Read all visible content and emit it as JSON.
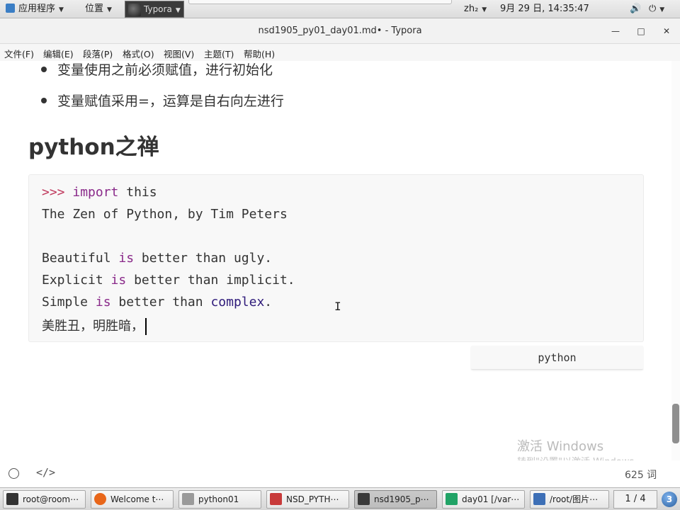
{
  "top_panel": {
    "apps_menu": "应用程序",
    "places_menu": "位置",
    "active_app": "Typora",
    "input_method": "zh₂",
    "datetime": "9月 29 日, 14:35:47"
  },
  "window": {
    "title": "nsd1905_py01_day01.md• - Typora",
    "minimize_glyph": "—",
    "maximize_glyph": "□",
    "close_glyph": "✕"
  },
  "menu": {
    "items": [
      "文件(F)",
      "编辑(E)",
      "段落(P)",
      "格式(O)",
      "视图(V)",
      "主题(T)",
      "帮助(H)"
    ]
  },
  "document": {
    "bullets": [
      "变量使用之前必须赋值，进行初始化",
      "变量赋值采用=，运算是自右向左进行"
    ],
    "heading_latin": "python",
    "heading_cn": "之禅",
    "code": {
      "prompt": ">>>",
      "import_kw": "import",
      "import_target": " this",
      "line2": "The Zen of Python, by Tim Peters",
      "line4_a": "Beautiful ",
      "line4_kw": "is",
      "line4_b": " better than ugly.",
      "line5_a": "Explicit ",
      "line5_kw": "is",
      "line5_b": " better than implicit.",
      "line6_a": "Simple ",
      "line6_kw": "is",
      "line6_b": " better than ",
      "line6_builtin": "complex",
      "line6_c": ".",
      "line7": "美胜丑，明胜暗，"
    },
    "code_language": "python"
  },
  "watermark": {
    "line1": "激活 Windows",
    "line2": "转到\"设置\"以激活 Windows。"
  },
  "statusbar": {
    "source_mode_glyph": "</>",
    "word_count": "625 词"
  },
  "taskbar": {
    "tasks": [
      {
        "label": "root@room⋯",
        "color": "#333333"
      },
      {
        "label": "Welcome t⋯",
        "color": "#e8661a"
      },
      {
        "label": "python01",
        "color": "#9a9a9a"
      },
      {
        "label": "NSD_PYTH⋯",
        "color": "#c83a3a"
      },
      {
        "label": "nsd1905_p⋯",
        "color": "#3a3a3a"
      },
      {
        "label": "day01 [/var⋯",
        "color": "#21a366"
      },
      {
        "label": "/root/图片⋯",
        "color": "#3d6fb6"
      }
    ],
    "pager": "1 / 4",
    "workspace_badge": "3"
  }
}
